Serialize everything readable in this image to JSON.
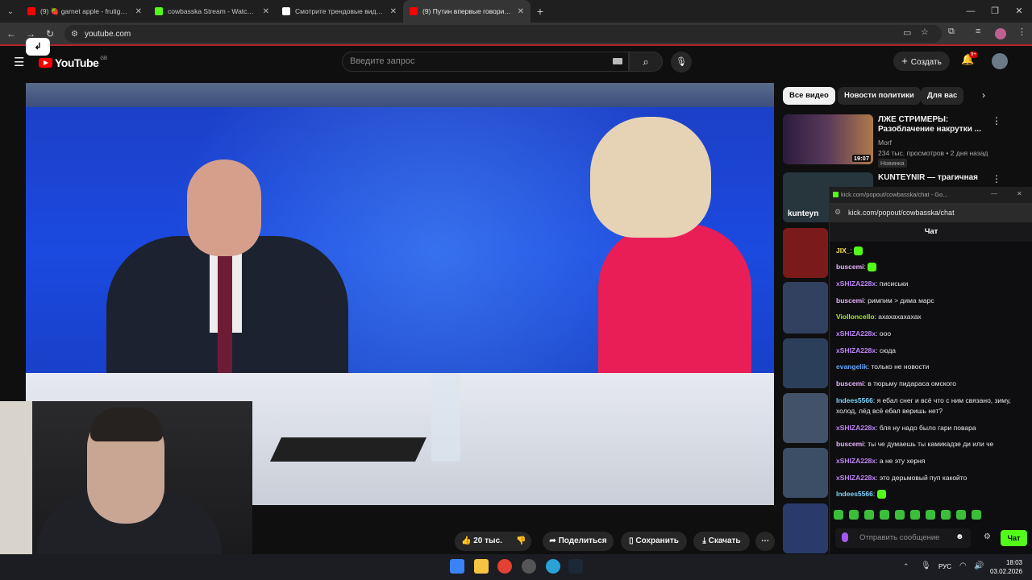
{
  "browser": {
    "tabs": [
      {
        "title": "(9) 🍓 garnet apple - frutiger a",
        "favicon_color": "#ff0000",
        "active": false
      },
      {
        "title": "cowbasska Stream - Watch Live",
        "favicon_color": "#53fc18",
        "active": false
      },
      {
        "title": "Смотрите трендовые видео |",
        "favicon_color": "#ffffff",
        "active": false
      },
      {
        "title": "(9) Путин впервые говорит пр",
        "favicon_color": "#ff0000",
        "active": true
      }
    ],
    "url": "youtube.com"
  },
  "youtube": {
    "logo_text": "YouTube",
    "country_code": "GB",
    "search_placeholder": "Введите запрос",
    "create_label": "Создать",
    "notif_count": "9+",
    "actions": {
      "likes": "20 тыс.",
      "share": "Поделиться",
      "save": "Сохранить",
      "download": "Скачать"
    },
    "chips": [
      "Все видео",
      "Новости политики",
      "Для вас"
    ],
    "recommendations": [
      {
        "title": "ЛЖЕ СТРИМЕРЫ: Разоблачение накрутки ...",
        "channel": "Morf",
        "meta": "234 тыс. просмотров • 2 дня назад",
        "badge": "Новинка",
        "duration": "19:07",
        "thumb_color": "#1d1d2e"
      },
      {
        "title": "KUNTEYNIR — трагичная",
        "thumb_text": "kunteyn",
        "thumb_color": "#27363d"
      }
    ]
  },
  "kick": {
    "window_title": "kick.com/popout/cowbasska/chat - Go...",
    "url": "kick.com/popout/cowbasska/chat",
    "header": "Чат",
    "messages": [
      {
        "user": "JIX_",
        "color": "#fbe14c",
        "text": "",
        "emote": true
      },
      {
        "user": "buscemi",
        "color": "#e6b2ff",
        "text": "",
        "emote": true
      },
      {
        "user": "xSHIZA228x",
        "color": "#c084fc",
        "text": "писиськи"
      },
      {
        "user": "buscemi",
        "color": "#e6b2ff",
        "text": "римпим > дима марс"
      },
      {
        "user": "Violloncello",
        "color": "#a3e635",
        "text": "ахахахахахах"
      },
      {
        "user": "xSHIZA228x",
        "color": "#c084fc",
        "text": "ооо"
      },
      {
        "user": "xSHIZA228x",
        "color": "#c084fc",
        "text": "сюда"
      },
      {
        "user": "evangelik",
        "color": "#60a5fa",
        "text": "только не новости"
      },
      {
        "user": "buscemi",
        "color": "#e6b2ff",
        "text": "в тюрьму пидараса омского"
      },
      {
        "user": "Indees5566",
        "color": "#7dd3fc",
        "text": "я ебал снег и всё что с ним связано, зиму, холод, лёд всё ебал веришь нет?"
      },
      {
        "user": "xSHIZA228x",
        "color": "#c084fc",
        "text": "бля ну надо было гари повара"
      },
      {
        "user": "buscemi",
        "color": "#e6b2ff",
        "text": "ты че думаешь ты камикадзе ди или че"
      },
      {
        "user": "xSHIZA228x",
        "color": "#c084fc",
        "text": "а не эту херня"
      },
      {
        "user": "xSHIZA228x",
        "color": "#c084fc",
        "text": "это дерьмовый пуп какойто"
      },
      {
        "user": "Indees5566",
        "color": "#7dd3fc",
        "text": "",
        "emote": true
      }
    ],
    "input_placeholder": "Отправить сообщение",
    "send_label": "Чат"
  },
  "taskbar": {
    "lang": "РУС",
    "time": "18:03",
    "date": "03.02.2026"
  }
}
